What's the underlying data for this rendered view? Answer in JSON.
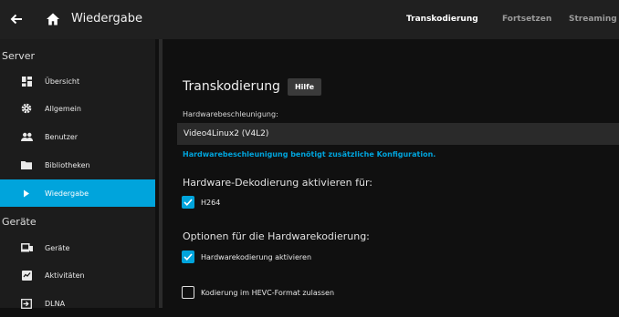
{
  "header": {
    "title": "Wiedergabe",
    "tabs": [
      {
        "label": "Transkodierung",
        "active": true
      },
      {
        "label": "Fortsetzen",
        "active": false
      },
      {
        "label": "Streaming",
        "active": false
      }
    ]
  },
  "sidebar": {
    "sections": [
      {
        "title": "Server",
        "items": [
          {
            "label": "Übersicht",
            "icon": "dashboard-icon"
          },
          {
            "label": "Allgemein",
            "icon": "gear-icon"
          },
          {
            "label": "Benutzer",
            "icon": "users-icon"
          },
          {
            "label": "Bibliotheken",
            "icon": "folder-icon"
          },
          {
            "label": "Wiedergabe",
            "icon": "play-icon",
            "active": true
          }
        ]
      },
      {
        "title": "Geräte",
        "items": [
          {
            "label": "Geräte",
            "icon": "devices-icon"
          },
          {
            "label": "Aktivitäten",
            "icon": "activity-icon"
          },
          {
            "label": "DLNA",
            "icon": "input-icon"
          }
        ]
      }
    ]
  },
  "main": {
    "heading": "Transkodierung",
    "help_label": "Hilfe",
    "hw_accel_label": "Hardwarebeschleunigung:",
    "hw_accel_value": "Video4Linux2 (V4L2)",
    "hw_accel_note": "Hardwarebeschleunigung benötigt zusätzliche Konfiguration.",
    "decoding_heading": "Hardware-Dekodierung aktivieren für:",
    "decoding_options": [
      {
        "label": "H264",
        "checked": true
      }
    ],
    "encoding_heading": "Optionen für die Hardwarekodierung:",
    "encoding_options": [
      {
        "label": "Hardwarekodierung aktivieren",
        "checked": true
      },
      {
        "label": "Kodierung im HEVC-Format zulassen",
        "checked": false
      }
    ]
  },
  "colors": {
    "accent": "#00a4dc",
    "background": "#101010",
    "sidebar": "#1c1c1c",
    "topbar": "#202020"
  }
}
